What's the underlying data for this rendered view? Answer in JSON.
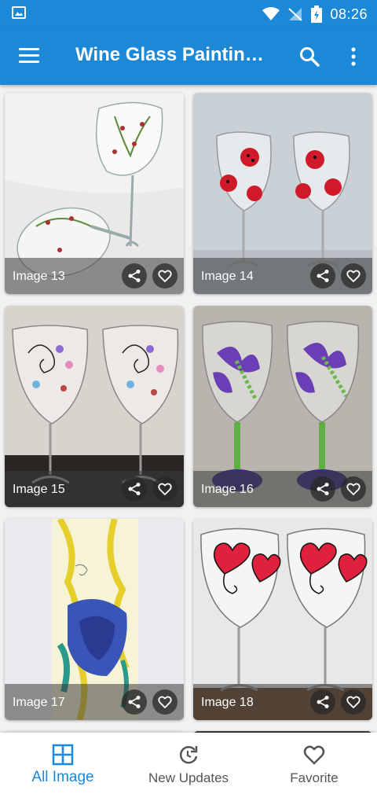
{
  "status_bar": {
    "time": "08:26"
  },
  "app_bar": {
    "title": "Wine Glass Paintin…",
    "icons": [
      "menu-icon",
      "search-icon",
      "more-vert-icon"
    ]
  },
  "gallery": {
    "items": [
      {
        "caption": "Image 13"
      },
      {
        "caption": "Image 14"
      },
      {
        "caption": "Image 15"
      },
      {
        "caption": "Image 16"
      },
      {
        "caption": "Image 17"
      },
      {
        "caption": "Image 18"
      }
    ]
  },
  "bottom_nav": {
    "items": [
      {
        "label": "All Image",
        "icon": "grid-icon",
        "active": true
      },
      {
        "label": "New Updates",
        "icon": "refresh-icon",
        "active": false
      },
      {
        "label": "Favorite",
        "icon": "heart-icon",
        "active": false
      }
    ]
  },
  "colors": {
    "primary": "#1b88d8",
    "overlay": "#3c3c3c"
  }
}
